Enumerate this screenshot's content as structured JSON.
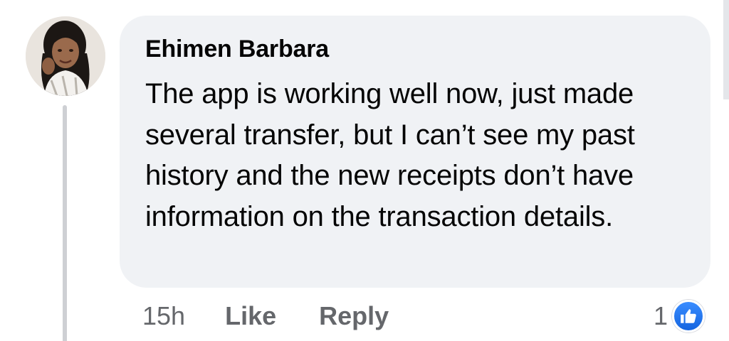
{
  "comment": {
    "author": "Ehimen Barbara",
    "text": "The app is working well now, just made several transfer, but I can’t see my past history and the new receipts don’t have information on the transaction details.",
    "timestamp": "15h",
    "like_label": "Like",
    "reply_label": "Reply",
    "reaction_count": "1",
    "reaction_icon": "thumbs-up-icon"
  },
  "colors": {
    "bubble": "#f0f2f5",
    "text": "#050505",
    "secondary_text": "#65676b",
    "like_blue": "#1877f2",
    "thread_line": "#ced0d4"
  }
}
